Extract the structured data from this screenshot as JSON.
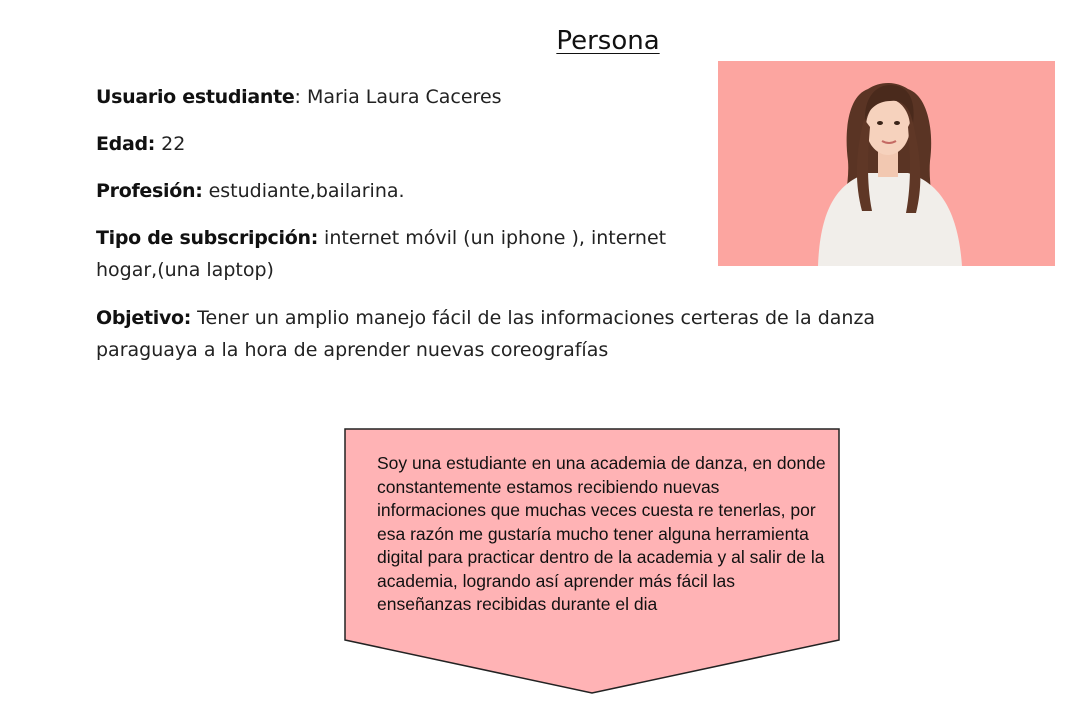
{
  "title": "Persona",
  "fields": {
    "user": {
      "label": "Usuario estudiante",
      "value": "Maria Laura Caceres"
    },
    "age": {
      "label": "Edad:",
      "value": "22"
    },
    "profession": {
      "label": "Profesión:",
      "value": "estudiante,bailarina."
    },
    "subscription": {
      "label": "Tipo de subscripción:",
      "value": "internet móvil (un iphone ), internet hogar,(una laptop)"
    },
    "objective": {
      "label": "Objetivo:",
      "value": "Tener un amplio manejo fácil de las informaciones certeras de la danza paraguaya a la hora de aprender nuevas coreografías"
    }
  },
  "photo": {
    "background": "#fca5a0",
    "icon": "woman-portrait-icon"
  },
  "callout": {
    "text": "Soy una estudiante en una academia de danza, en donde constantemente estamos recibiendo nuevas informaciones que muchas veces cuesta re tenerlas, por esa razón me gustaría mucho tener alguna herramienta digital para practicar dentro de la academia y al salir de la academia, logrando así aprender más fácil las enseñanzas recibidas durante el dia",
    "fill": "#ffb3b5",
    "border": "#222222"
  }
}
